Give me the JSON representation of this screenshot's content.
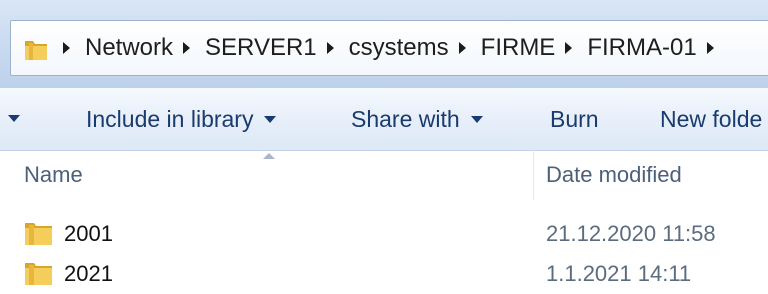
{
  "address_bar": {
    "crumbs": [
      "Network",
      "SERVER1",
      "csystems",
      "FIRME",
      "FIRMA-01"
    ]
  },
  "command_bar": {
    "include_in_library": "Include in library",
    "share_with": "Share with",
    "burn": "Burn",
    "new_folder": "New folde"
  },
  "columns": {
    "name": "Name",
    "date_modified": "Date modified"
  },
  "files": [
    {
      "name": "2001",
      "date_modified": "21.12.2020 11:58",
      "icon": "folder-icon"
    },
    {
      "name": "2021",
      "date_modified": "1.1.2021 14:11",
      "icon": "folder-icon"
    }
  ],
  "colors": {
    "command_text": "#1a3b6e",
    "column_header_text": "#4c607a",
    "folder_yellow": "#f0c54a"
  }
}
